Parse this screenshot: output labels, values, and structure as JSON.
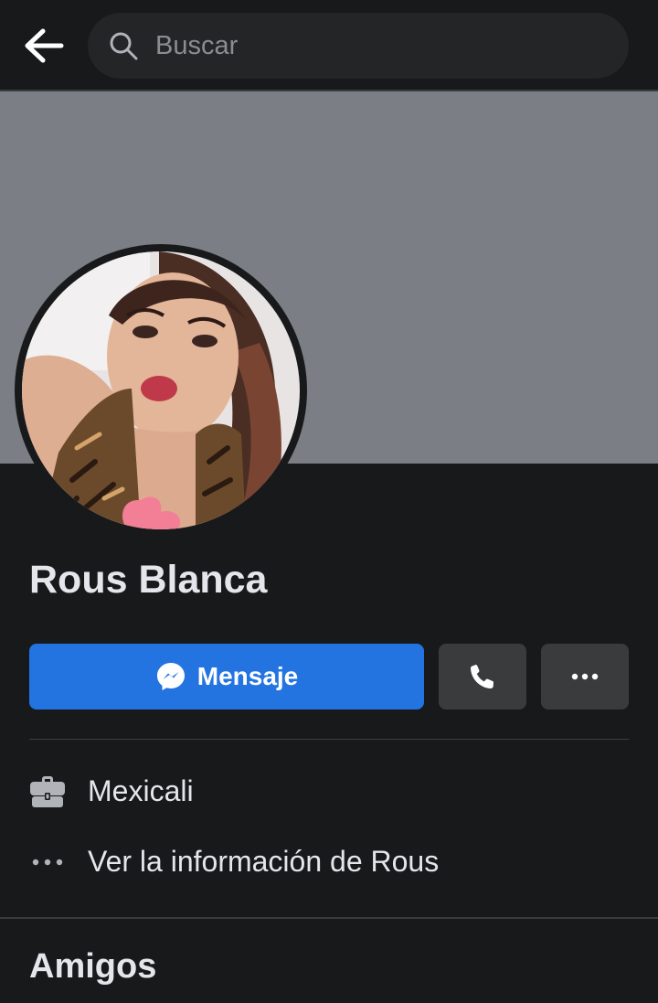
{
  "search": {
    "placeholder": "Buscar"
  },
  "profile": {
    "name": "Rous Blanca"
  },
  "actions": {
    "message_label": "Mensaje",
    "accent_color": "#2374e1"
  },
  "info": [
    {
      "icon": "briefcase-icon",
      "text": "Mexicali"
    },
    {
      "icon": "more-dots-icon",
      "text": "Ver la información de Rous"
    }
  ],
  "sections": {
    "friends_title": "Amigos"
  },
  "colors": {
    "background": "#18191a",
    "cover": "#7b7f85",
    "secondary_button": "#3a3b3c"
  }
}
